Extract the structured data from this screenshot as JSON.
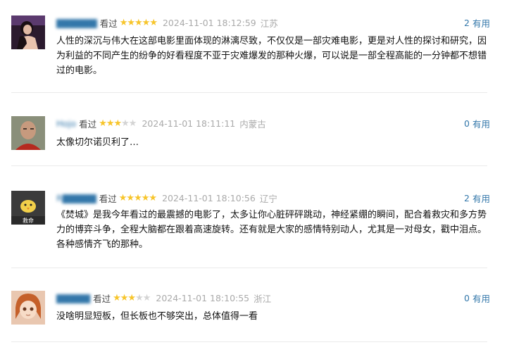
{
  "reviews": [
    {
      "username": "▇▇▇▇▇▇",
      "action": "看过",
      "rating": 5,
      "time": "2024-11-01 18:12:59",
      "location": "江苏",
      "useful_count": "2",
      "useful_label": "有用",
      "content": "人性的深沉与伟大在这部电影里面体现的淋漓尽致，不仅仅是一部灾难电影，更是对人性的探讨和研究，因为利益的不同产生的纷争的好看程度不亚于灾难爆发的那种火爆，可以说是一部全程高能的一分钟都不想错过的电影。"
    },
    {
      "username": "Hojo",
      "action": "看过",
      "rating": 3,
      "time": "2024-11-01 18:11:11",
      "location": "内蒙古",
      "useful_count": "0",
      "useful_label": "有用",
      "content": "太像切尔诺贝利了…"
    },
    {
      "username": "R▇▇▇▇▇",
      "action": "看过",
      "rating": 5,
      "time": "2024-11-01 18:10:56",
      "location": "辽宁",
      "useful_count": "2",
      "useful_label": "有用",
      "avatar_text": "救命",
      "content": "《焚城》是我今年看过的最震撼的电影了，太多让你心脏砰砰跳动，神经紧绷的瞬间，配合着救灾和多方势力的博弈斗争，全程大脑都在跟着高速旋转。还有就是大家的感情特别动人，尤其是一对母女，戳中泪点。各种感情齐飞的那种。"
    },
    {
      "username": "▇▇▇▇▇",
      "action": "看过",
      "rating": 3,
      "time": "2024-11-01 18:10:55",
      "location": "浙江",
      "useful_count": "0",
      "useful_label": "有用",
      "content": "没啥明显短板，但长板也不够突出，总体值得一看"
    }
  ],
  "colors": {
    "link": "#3377aa",
    "star": "#f7c52b",
    "star_off": "#d4d4d4",
    "meta": "#aaaaaa"
  }
}
